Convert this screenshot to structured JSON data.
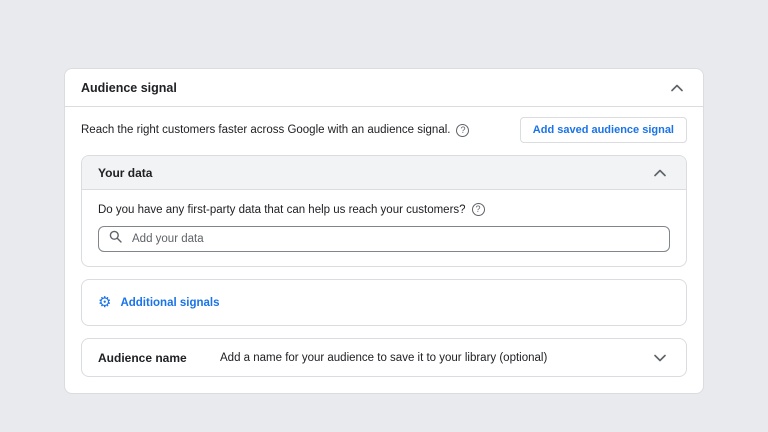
{
  "panel": {
    "title": "Audience signal",
    "description": "Reach the right customers faster across Google with an audience signal.",
    "add_saved_button_label": "Add saved audience signal"
  },
  "your_data": {
    "title": "Your data",
    "question": "Do you have any first-party data that can help us reach your customers?",
    "input_placeholder": "Add your data",
    "input_value": ""
  },
  "additional_signals": {
    "label": "Additional signals"
  },
  "audience_name": {
    "label": "Audience name",
    "description": "Add a name for your audience to save it to your library (optional)"
  },
  "icons": {
    "help_glyph": "?",
    "gear_glyph": "⚙"
  },
  "colors": {
    "accent_blue": "#1a73e8",
    "page_background": "#e8eaed",
    "border_gray": "#dadce0",
    "section_header_bg": "#f1f3f4",
    "secondary_text": "#5f6368"
  }
}
